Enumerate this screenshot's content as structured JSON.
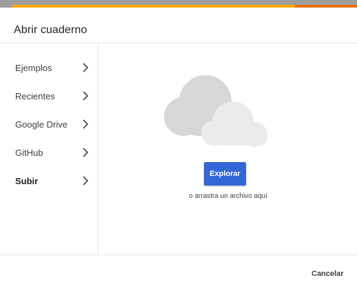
{
  "dialog": {
    "title": "Abrir cuaderno"
  },
  "sidebar": {
    "items": [
      {
        "label": "Ejemplos",
        "icon": "chevron-right-icon"
      },
      {
        "label": "Recientes",
        "icon": "chevron-right-icon"
      },
      {
        "label": "Google Drive",
        "icon": "chevron-right-icon"
      },
      {
        "label": "GitHub",
        "icon": "chevron-right-icon"
      },
      {
        "label": "Subir",
        "icon": "chevron-right-icon",
        "active": true
      }
    ]
  },
  "upload": {
    "icon": "cloud-icon",
    "button_label": "Explorar",
    "drag_text": "o arrastra un archivo aquí"
  },
  "footer": {
    "cancel_label": "Cancelar"
  },
  "colors": {
    "accent_yellow": "#f9ab00",
    "accent_orange": "#e8710a",
    "button_blue": "#3367d6",
    "cloud_back": "#d7d7d7",
    "cloud_front": "#ebebeb"
  }
}
